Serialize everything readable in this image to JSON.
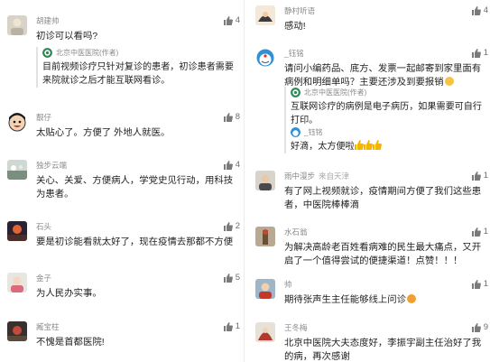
{
  "left": [
    {
      "name": "胡建帅",
      "text": "初诊可以看吗?",
      "likes": "4",
      "reply": {
        "name": "北京中医医院(作者)",
        "text": "目前视频诊疗只针对复诊的患者，初诊患者需要来院就诊之后才能互联网看诊。"
      }
    },
    {
      "name": "靓仔",
      "text": "太贴心了。方便了 外地人就医。",
      "likes": "8"
    },
    {
      "name": "独步云端",
      "text": "关心、关爱、方便病人，学党史见行动，用科技为患者。",
      "likes": "4"
    },
    {
      "name": "石头",
      "text": "要是初诊能看就太好了，现在疫情去那都不方便",
      "likes": "2"
    },
    {
      "name": "金子",
      "text": "为人民办实事。",
      "likes": "5"
    },
    {
      "name": "臧宝柱",
      "text": "不愧是首都医院!",
      "likes": "1"
    }
  ],
  "right": [
    {
      "name": "静村听语",
      "text": "感动!",
      "likes": "4"
    },
    {
      "name": "_钰铭",
      "text": "请问小编药品、底方、发票一起邮寄到家里面有病例和明细单吗？主要还涉及到要报销",
      "likes": "1",
      "replies": [
        {
          "name": "北京中医医院(作者)",
          "text": "互联网诊疗的病例是电子病历，如果需要可自行打印。"
        },
        {
          "name": "_钰铭",
          "text": "好滴，太方便啦"
        }
      ]
    },
    {
      "name": "雨中漫步",
      "location": "来自天津",
      "text": "有了网上视频就诊，疫情期间方便了我们这些患者，中医院棒棒滴",
      "likes": "1"
    },
    {
      "name": "水石翁",
      "text": "为解决高龄老百姓看病难的民生最大痛点，又开启了一个值得尝试的便捷渠道！点赞！！！",
      "likes": "1"
    },
    {
      "name": "帅",
      "text": "期待张声生主任能够线上问诊",
      "likes": "1"
    },
    {
      "name": "王冬梅",
      "text": "北京中医院大夫态度好，李振宇副主任治好了我的病，再次感谢",
      "likes": "9"
    }
  ],
  "colors": {
    "name": "#8a8a8a",
    "text": "#1f1f1f",
    "likes": "#6e6e6e",
    "reply_bar": "#e2e2e2"
  },
  "icons": {
    "like": "thumbs-up-icon",
    "author_badge": "hospital-logo-icon"
  }
}
